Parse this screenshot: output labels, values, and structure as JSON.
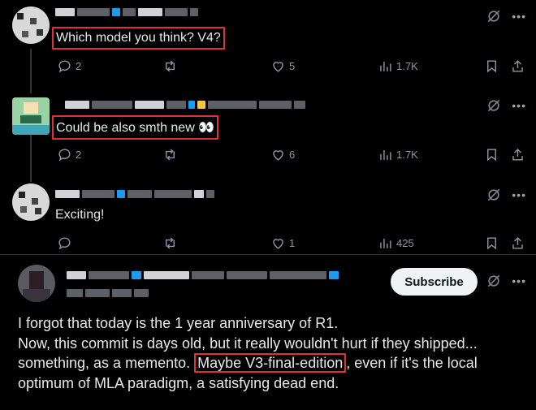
{
  "tweets": [
    {
      "text": "Which model you think? V4?",
      "replies": "2",
      "retweets": "",
      "likes": "5",
      "views": "1.7K"
    },
    {
      "text": "Could be also smth new",
      "emoji": "👀",
      "replies": "2",
      "retweets": "",
      "likes": "6",
      "views": "1.7K"
    },
    {
      "text": "Exciting!",
      "replies": "",
      "retweets": "",
      "likes": "1",
      "views": "425"
    }
  ],
  "main_tweet": {
    "subscribe_label": "Subscribe",
    "line1": "I forgot that today is the 1 year anniversary of R1.",
    "line2": "Now, this commit is days old, but it really wouldn't hurt if they shipped...",
    "line3_pre": "something, as a memento.",
    "line3_hl": "Maybe V3-final-edition",
    "line3_post": ", even if it's the local",
    "line4": "optimum of MLA paradigm, a satisfying dead end."
  },
  "icons": {
    "reply": "reply-icon",
    "retweet": "retweet-icon",
    "like": "heart-icon",
    "views": "views-icon",
    "bookmark": "bookmark-icon",
    "share": "share-icon",
    "grok": "grok-icon",
    "more": "more-icon"
  },
  "colors": {
    "background": "#000000",
    "text": "#e7e9ea",
    "muted": "#8b98a5",
    "highlight_border": "#e0303a",
    "verified": "#1d9bf0"
  }
}
